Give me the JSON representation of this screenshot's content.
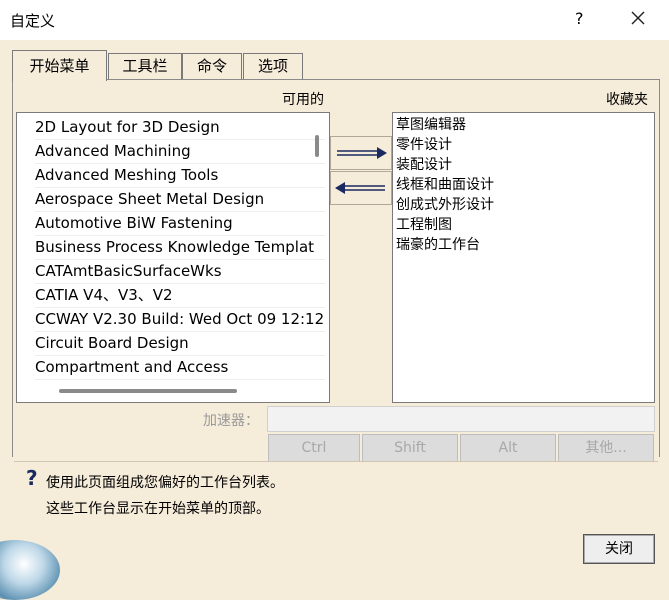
{
  "window": {
    "title": "自定义",
    "help": "?"
  },
  "tabs": [
    {
      "label": "开始菜单"
    },
    {
      "label": "工具栏"
    },
    {
      "label": "命令"
    },
    {
      "label": "选项"
    }
  ],
  "available": {
    "label": "可用的",
    "items": [
      "2D Layout for 3D Design",
      "Advanced Machining",
      "Advanced Meshing Tools",
      "Aerospace Sheet Metal  Design",
      "Automotive BiW Fastening",
      "Business Process Knowledge Templat",
      "CATAmtBasicSurfaceWks",
      "CATIA V4、V3、V2",
      "CCWAY V2.30 Build: Wed Oct 09 12:12",
      "Circuit Board Design",
      "Compartment and Access"
    ]
  },
  "favorites": {
    "label": "收藏夹",
    "items": [
      "草图编辑器",
      "零件设计",
      "装配设计",
      "线框和曲面设计",
      "创成式外形设计",
      "工程制图",
      "瑞豪的工作台"
    ]
  },
  "accelerator": {
    "label": "加速器：",
    "value": "",
    "buttons": {
      "ctrl": "Ctrl",
      "shift": "Shift",
      "alt": "Alt",
      "other": "其他..."
    }
  },
  "info": {
    "line1": "使用此页面组成您偏好的工作台列表。",
    "line2": "这些工作台显示在开始菜单的顶部。"
  },
  "footer": {
    "close_label": "关闭"
  },
  "icons": {
    "close": "close-icon",
    "add": "arrow-right-icon",
    "remove": "arrow-left-icon",
    "info": "question-icon"
  }
}
